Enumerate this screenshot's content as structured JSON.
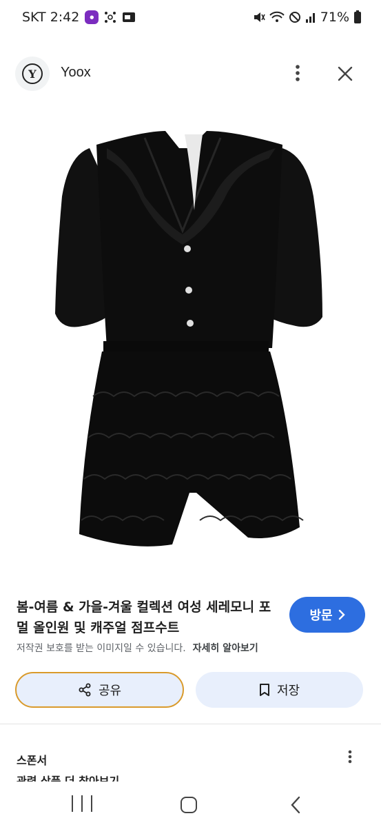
{
  "status_bar": {
    "carrier_time": "SKT 2:42",
    "battery": "71%",
    "icons": [
      "app-notification-icon",
      "share-network-icon",
      "screen-cast-icon",
      "mute-icon",
      "wifi-icon",
      "no-disturb-icon",
      "signal-icon",
      "battery-icon"
    ]
  },
  "header": {
    "logo_letter": "Y",
    "site_name": "Yoox"
  },
  "product": {
    "image_subject": "black-lace-romper"
  },
  "info": {
    "title": "봄-여름 & 가을-겨울 컬렉션 여성 세레모니 포멀 올인원 및 캐주얼 점프수트",
    "visit_label": "방문",
    "copyright_text": "저작권 보호를 받는 이미지일 수 있습니다.",
    "learn_more_label": "자세히 알아보기"
  },
  "actions": {
    "share_label": "공유",
    "save_label": "저장"
  },
  "sponsored": {
    "label": "스폰서",
    "partial_text": "관련 상품 더 찾아보기"
  },
  "colors": {
    "accent_blue": "#2d6ee0",
    "button_bg": "#e8effc",
    "focus_ring": "#d99a2b"
  }
}
